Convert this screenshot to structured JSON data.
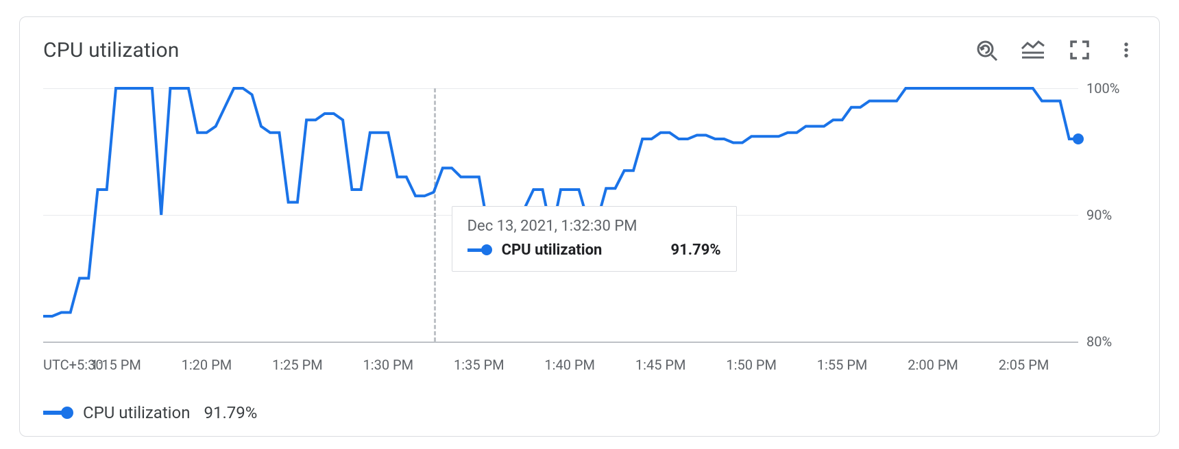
{
  "header": {
    "title": "CPU utilization"
  },
  "tooltip": {
    "timestamp": "Dec 13, 2021, 1:32:30 PM",
    "series_name": "CPU utilization",
    "value": "91.79%"
  },
  "legend": {
    "series_name": "CPU utilization",
    "value": "91.79%"
  },
  "yaxis": {
    "ticks": [
      "100%",
      "90%",
      "80%"
    ]
  },
  "xaxis": {
    "tz_label": "UTC+5:30",
    "ticks": [
      "1:15 PM",
      "1:20 PM",
      "1:25 PM",
      "1:30 PM",
      "1:35 PM",
      "1:40 PM",
      "1:45 PM",
      "1:50 PM",
      "1:55 PM",
      "2:00 PM",
      "2:05 PM"
    ]
  },
  "chart_data": {
    "type": "line",
    "title": "CPU utilization",
    "xlabel": "",
    "ylabel": "",
    "ylim": [
      80,
      100
    ],
    "timezone": "UTC+5:30",
    "crosshair_x": "1:32:30 PM",
    "crosshair_value": 91.79,
    "x_start": "1:11 PM",
    "x_end": "2:08 PM",
    "series": [
      {
        "name": "CPU utilization",
        "color": "#1a73e8",
        "x": [
          "1:11:00 PM",
          "1:11:30 PM",
          "1:12:00 PM",
          "1:12:30 PM",
          "1:13:00 PM",
          "1:13:30 PM",
          "1:14:00 PM",
          "1:14:30 PM",
          "1:15:00 PM",
          "1:15:30 PM",
          "1:16:00 PM",
          "1:16:30 PM",
          "1:17:00 PM",
          "1:17:30 PM",
          "1:18:00 PM",
          "1:18:30 PM",
          "1:19:00 PM",
          "1:19:30 PM",
          "1:20:00 PM",
          "1:20:30 PM",
          "1:21:00 PM",
          "1:21:30 PM",
          "1:22:00 PM",
          "1:22:30 PM",
          "1:23:00 PM",
          "1:23:30 PM",
          "1:24:00 PM",
          "1:24:30 PM",
          "1:25:00 PM",
          "1:25:30 PM",
          "1:26:00 PM",
          "1:26:30 PM",
          "1:27:00 PM",
          "1:27:30 PM",
          "1:28:00 PM",
          "1:28:30 PM",
          "1:29:00 PM",
          "1:29:30 PM",
          "1:30:00 PM",
          "1:30:30 PM",
          "1:31:00 PM",
          "1:31:30 PM",
          "1:32:00 PM",
          "1:32:30 PM",
          "1:33:00 PM",
          "1:33:30 PM",
          "1:34:00 PM",
          "1:34:30 PM",
          "1:35:00 PM",
          "1:35:30 PM",
          "1:36:00 PM",
          "1:36:30 PM",
          "1:37:00 PM",
          "1:37:30 PM",
          "1:38:00 PM",
          "1:38:30 PM",
          "1:39:00 PM",
          "1:39:30 PM",
          "1:40:00 PM",
          "1:40:30 PM",
          "1:41:00 PM",
          "1:41:30 PM",
          "1:42:00 PM",
          "1:42:30 PM",
          "1:43:00 PM",
          "1:43:30 PM",
          "1:44:00 PM",
          "1:44:30 PM",
          "1:45:00 PM",
          "1:45:30 PM",
          "1:46:00 PM",
          "1:46:30 PM",
          "1:47:00 PM",
          "1:47:30 PM",
          "1:48:00 PM",
          "1:48:30 PM",
          "1:49:00 PM",
          "1:49:30 PM",
          "1:50:00 PM",
          "1:50:30 PM",
          "1:51:00 PM",
          "1:51:30 PM",
          "1:52:00 PM",
          "1:52:30 PM",
          "1:53:00 PM",
          "1:53:30 PM",
          "1:54:00 PM",
          "1:54:30 PM",
          "1:55:00 PM",
          "1:55:30 PM",
          "1:56:00 PM",
          "1:56:30 PM",
          "1:57:00 PM",
          "1:57:30 PM",
          "1:58:00 PM",
          "1:58:30 PM",
          "1:59:00 PM",
          "1:59:30 PM",
          "2:00:00 PM",
          "2:00:30 PM",
          "2:01:00 PM",
          "2:01:30 PM",
          "2:02:00 PM",
          "2:02:30 PM",
          "2:03:00 PM",
          "2:03:30 PM",
          "2:04:00 PM",
          "2:04:30 PM",
          "2:05:00 PM",
          "2:05:30 PM",
          "2:06:00 PM",
          "2:06:30 PM",
          "2:07:00 PM",
          "2:07:30 PM",
          "2:08:00 PM"
        ],
        "values": [
          82.0,
          82.0,
          82.3,
          82.3,
          85.0,
          85.0,
          92.0,
          92.0,
          100.0,
          100.0,
          100.0,
          100.0,
          100.0,
          90.0,
          100.0,
          100.0,
          100.0,
          96.5,
          96.5,
          97.0,
          98.5,
          100.0,
          100.0,
          99.5,
          97.0,
          96.5,
          96.5,
          91.0,
          91.0,
          97.5,
          97.5,
          98.0,
          98.0,
          97.5,
          92.0,
          92.0,
          96.5,
          96.5,
          96.5,
          93.0,
          93.0,
          91.5,
          91.5,
          91.79,
          93.7,
          93.7,
          93.0,
          93.0,
          93.0,
          89.0,
          88.0,
          88.3,
          90.5,
          90.5,
          92.0,
          92.0,
          88.5,
          92.0,
          92.0,
          92.0,
          89.5,
          89.5,
          92.1,
          92.1,
          93.5,
          93.5,
          96.0,
          96.0,
          96.5,
          96.5,
          96.0,
          96.0,
          96.3,
          96.3,
          96.0,
          96.0,
          95.7,
          95.7,
          96.2,
          96.2,
          96.2,
          96.2,
          96.5,
          96.5,
          97.0,
          97.0,
          97.0,
          97.5,
          97.5,
          98.5,
          98.5,
          99.0,
          99.0,
          99.0,
          99.0,
          100.0,
          100.0,
          100.0,
          100.0,
          100.0,
          100.0,
          100.0,
          100.0,
          100.0,
          100.0,
          100.0,
          100.0,
          100.0,
          100.0,
          100.0,
          99.0,
          99.0,
          99.0,
          96.0,
          96.0
        ]
      }
    ]
  }
}
